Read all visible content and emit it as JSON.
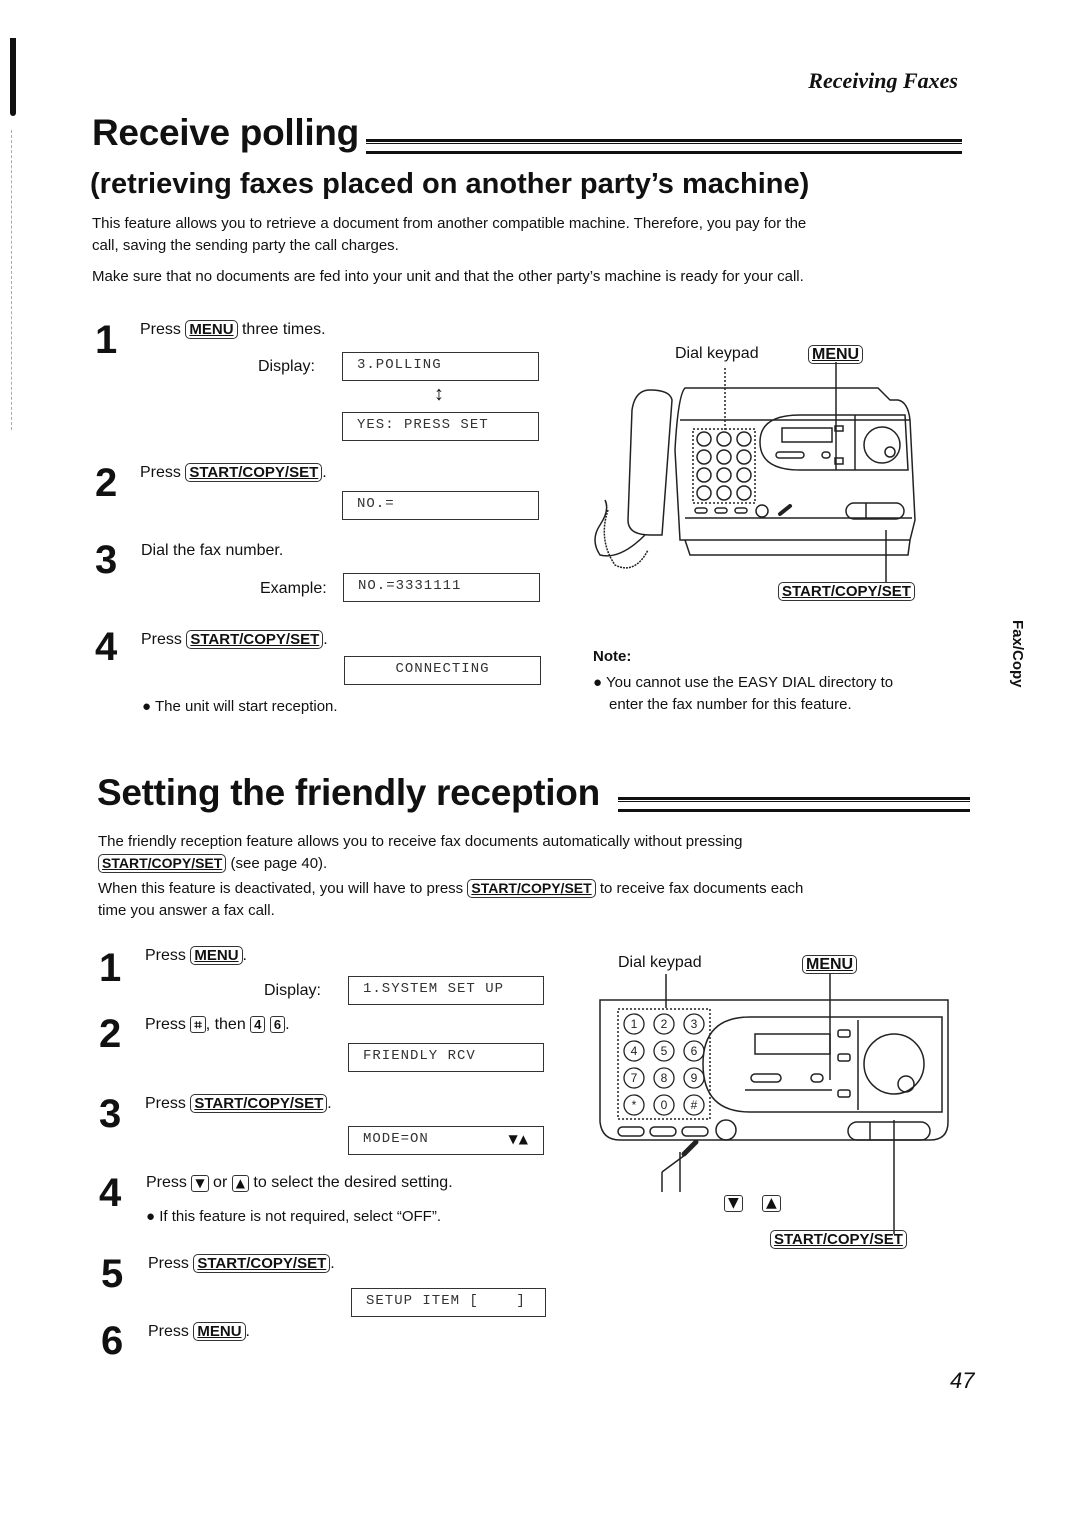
{
  "header": {
    "section_label": "Receiving Faxes"
  },
  "polling": {
    "title": "Receive polling",
    "subtitle": "(retrieving faxes placed on another party’s machine)",
    "intro_1_line1": "This feature allows you to retrieve a document from another compatible machine. Therefore, you pay for the",
    "intro_1_line2": "call, saving the sending party the call charges.",
    "intro_2": "Make sure that no documents are fed into your unit and that the other party’s machine is ready for your call.",
    "steps": [
      {
        "num": "1",
        "pre": "Press",
        "key": "MENU",
        "post": "three times.",
        "display_label": "Display:",
        "displays": [
          "3.POLLING",
          "YES: PRESS SET"
        ],
        "toggle_icon": "↕"
      },
      {
        "num": "2",
        "pre": "Press",
        "key": "START/COPY/SET",
        "post": ".",
        "displays": [
          "NO.="
        ]
      },
      {
        "num": "3",
        "text": "Dial the fax number.",
        "display_label": "Example:",
        "displays": [
          "NO.=3331111"
        ]
      },
      {
        "num": "4",
        "pre": "Press",
        "key": "START/COPY/SET",
        "post": ".",
        "displays": [
          "CONNECTING"
        ],
        "bullet": "The unit will start reception."
      }
    ],
    "diagram": {
      "dial_keypad_label": "Dial keypad",
      "menu_key": "MENU",
      "start_key": "START/COPY/SET"
    },
    "note": {
      "title": "Note:",
      "line1": "You cannot use the EASY DIAL directory to",
      "line2": "enter the fax number for this feature."
    }
  },
  "side_tab": "Fax/Copy",
  "friendly": {
    "title": "Setting the friendly reception",
    "intro_1_line1": "The friendly reception feature allows you to receive fax documents automatically without pressing",
    "intro_1_key": "START/COPY/SET",
    "intro_1_tail": "(see page 40).",
    "intro_2_pre": "When this feature is deactivated, you will have to press",
    "intro_2_key": "START/COPY/SET",
    "intro_2_post": "to receive fax documents each",
    "intro_2_line2": "time you answer a fax call.",
    "steps": [
      {
        "num": "1",
        "pre": "Press",
        "key": "MENU",
        "post": ".",
        "display_label": "Display:",
        "displays": [
          "1.SYSTEM SET UP"
        ]
      },
      {
        "num": "2",
        "pre": "Press",
        "key": "⌗",
        "mid": ", then",
        "keys2": [
          "4",
          "6"
        ],
        "post": ".",
        "displays": [
          "FRIENDLY RCV"
        ]
      },
      {
        "num": "3",
        "pre": "Press",
        "key": "START/COPY/SET",
        "post": ".",
        "displays": [
          "MODE=ON"
        ],
        "display_arrows": "▼▲"
      },
      {
        "num": "4",
        "pre": "Press",
        "key": "▼",
        "mid": "or",
        "key2": "▲",
        "post": "to select the desired setting.",
        "bullet": "If this feature is not required, select “OFF”."
      },
      {
        "num": "5",
        "pre": "Press",
        "key": "START/COPY/SET",
        "post": ".",
        "displays": [
          "SETUP ITEM [    ]"
        ]
      },
      {
        "num": "6",
        "pre": "Press",
        "key": "MENU",
        "post": "."
      }
    ],
    "diagram": {
      "dial_keypad_label": "Dial keypad",
      "menu_key": "MENU",
      "start_key": "START/COPY/SET",
      "keypad_keys": [
        "1",
        "2",
        "3",
        "4",
        "5",
        "6",
        "7",
        "8",
        "9",
        "*",
        "0",
        "#"
      ],
      "down_key": "▼",
      "up_key": "▲"
    }
  },
  "footer": {
    "page_number": "47"
  }
}
